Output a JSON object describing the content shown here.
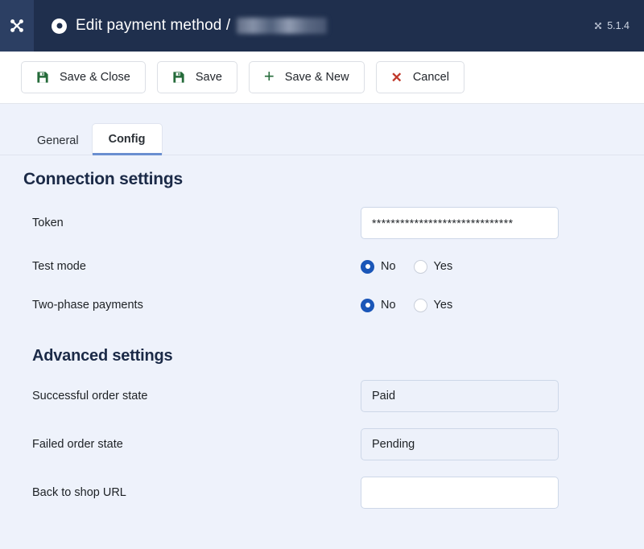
{
  "header": {
    "logo_icon": "joomla-logo-icon",
    "status_icon": "record-dot-icon",
    "title": "Edit payment method /",
    "redacted_label": "",
    "version_icon": "joomla-mark-icon",
    "version": "5.1.4"
  },
  "toolbar": {
    "buttons": [
      {
        "label": "Save & Close",
        "icon": "save-icon"
      },
      {
        "label": "Save",
        "icon": "save-icon"
      },
      {
        "label": "Save & New",
        "icon": "plus-icon"
      },
      {
        "label": "Cancel",
        "icon": "close-icon"
      }
    ]
  },
  "tabs": [
    {
      "label": "General",
      "active": false
    },
    {
      "label": "Config",
      "active": true
    }
  ],
  "sections": {
    "connection": {
      "title": "Connection settings",
      "fields": {
        "token": {
          "label": "Token",
          "value": "******************************",
          "placeholder": ""
        },
        "test_mode": {
          "label": "Test mode",
          "options": [
            "No",
            "Yes"
          ],
          "selected": "No"
        },
        "two_phase": {
          "label": "Two-phase payments",
          "options": [
            "No",
            "Yes"
          ],
          "selected": "No"
        }
      }
    },
    "advanced": {
      "title": "Advanced settings",
      "fields": {
        "success_state": {
          "label": "Successful order state",
          "value": "Paid"
        },
        "failed_state": {
          "label": "Failed order state",
          "value": "Pending"
        },
        "back_url": {
          "label": "Back to shop URL",
          "value": "",
          "placeholder": ""
        }
      }
    }
  },
  "colors": {
    "header_bg": "#1f2f4d",
    "logo_panel_bg": "#2c3f63",
    "page_bg": "#eef2fb",
    "toolbar_bg": "#ffffff",
    "accent_blue": "#1a56b8",
    "tab_underline": "#6a8fd0",
    "save_icon_green": "#256b3a",
    "cancel_icon_red": "#c0392b",
    "heading_navy": "#1b2a47"
  }
}
